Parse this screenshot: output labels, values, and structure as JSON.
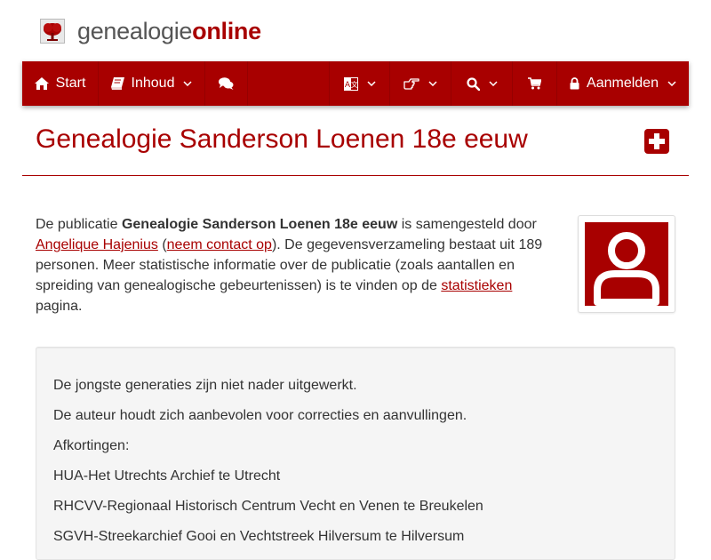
{
  "logo": {
    "text_plain": "genealogie",
    "text_bold": "online"
  },
  "nav": {
    "start_label": "Start",
    "inhoud_label": "Inhoud",
    "login_label": "Aanmelden",
    "icons": [
      "home-icon",
      "book-icon",
      "comments-icon",
      "language-icon",
      "hand-pointer-icon",
      "search-icon",
      "shopping-cart-icon",
      "lock-icon"
    ]
  },
  "title": "Genealogie Sanderson Loenen 18e eeuw",
  "intro": {
    "text1": "De publicatie ",
    "pub_name": "Genealogie Sanderson Loenen 18e eeuw",
    "text2": " is samengesteld door ",
    "author": "Angelique Hajenius",
    "paren_open": " (",
    "contact": "neem contact op",
    "text3": "). De gegevensverzameling bestaat uit 189 personen. Meer statistische informatie over de publicatie (zoals aantallen en spreiding van genealogische gebeurtenissen) is te vinden op de ",
    "stats": "statistieken",
    "text4": " pagina."
  },
  "notes": [
    "De jongste generaties zijn niet nader uitgewerkt.",
    "De auteur houdt zich aanbevolen voor correcties en aanvullingen.",
    "Afkortingen:",
    "HUA-Het Utrechts Archief te Utrecht",
    "RHCVV-Regionaal Historisch Centrum Vecht en Venen te Breukelen",
    "SGVH-Streekarchief Gooi en Vechtstreek Hilversum te Hilversum"
  ],
  "colors": {
    "brand": "#a80000",
    "text": "#333333",
    "logo_gray": "#555555"
  }
}
